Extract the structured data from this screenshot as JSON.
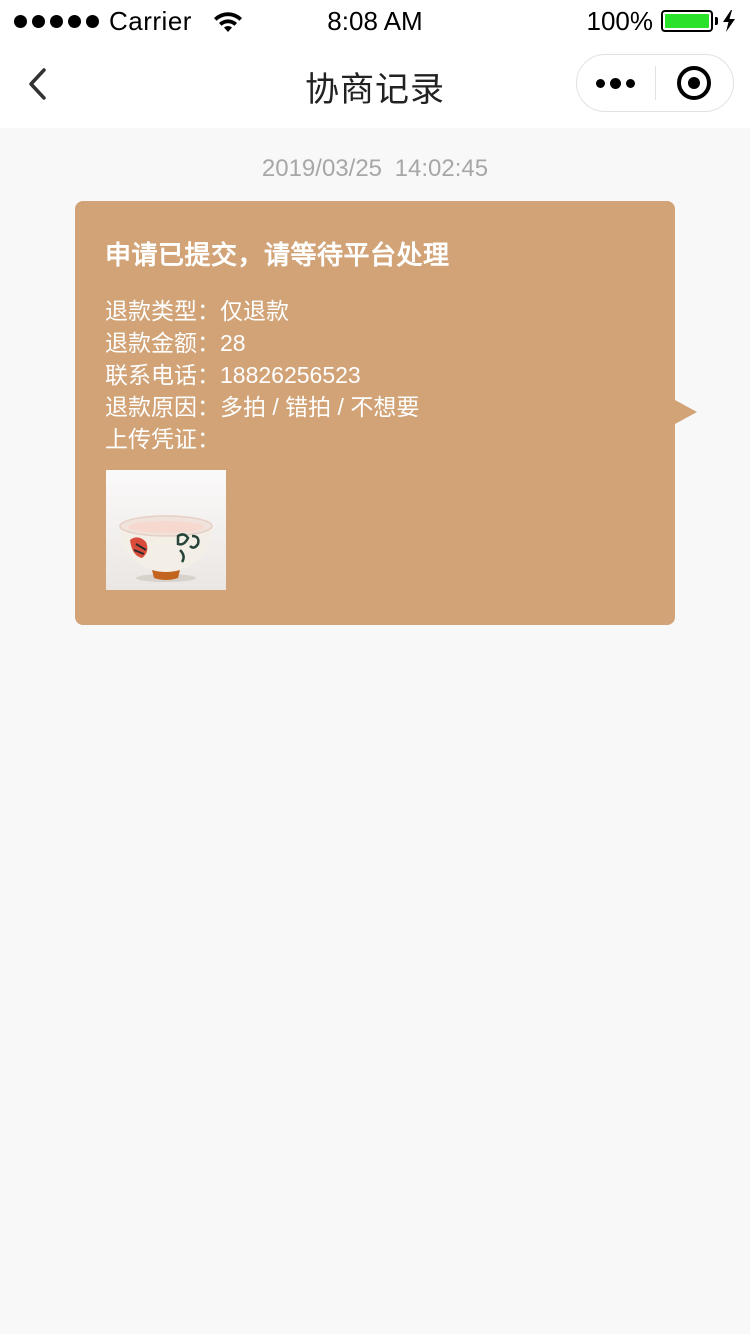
{
  "status_bar": {
    "carrier": "Carrier",
    "time": "8:08 AM",
    "battery": "100%",
    "battery_level": 1.0,
    "battery_color": "#2be22b"
  },
  "nav": {
    "title": "协商记录",
    "back_icon": "chevron-left-icon",
    "more_icon": "more-dots-icon",
    "close_icon": "target-close-icon"
  },
  "message": {
    "timestamp": "2019/03/25  14:02:45",
    "title": "申请已提交，请等待平台处理",
    "lines": [
      "退款类型：仅退款",
      "退款金额：28",
      "联系电话：18826256523",
      "退款原因：多拍 / 错拍 / 不想要",
      "上传凭证："
    ],
    "attachment_icon": "rice-bowl-photo",
    "bubble_color": "#d1a377"
  }
}
